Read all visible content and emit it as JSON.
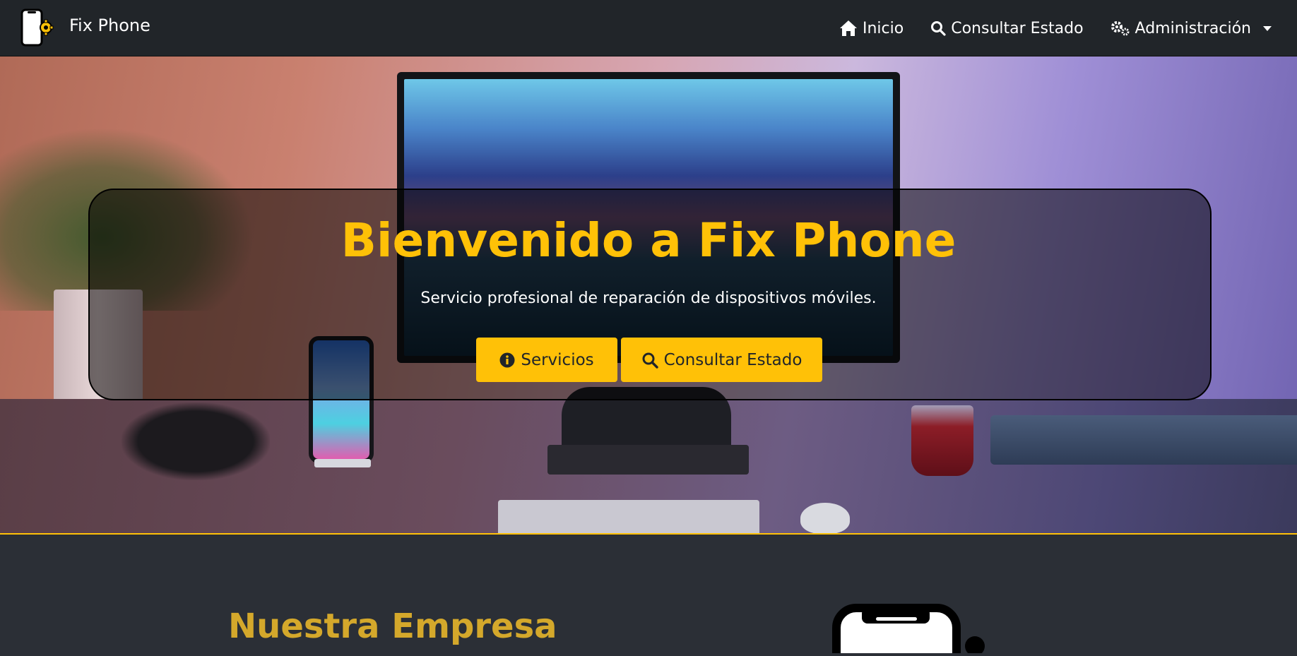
{
  "navbar": {
    "brand_name": "Fix Phone",
    "brand_icon": "phone-gear-logo",
    "items": [
      {
        "label": "Inicio",
        "icon": "home-icon"
      },
      {
        "label": "Consultar Estado",
        "icon": "search-icon"
      },
      {
        "label": "Administración",
        "icon": "gears-icon",
        "dropdown": true
      }
    ]
  },
  "hero": {
    "title": "Bienvenido a Fix Phone",
    "subtitle": "Servicio profesional de reparación de dispositivos móviles.",
    "buttons": [
      {
        "label": "Servicios",
        "icon": "info-circle-icon"
      },
      {
        "label": "Consultar Estado",
        "icon": "search-icon"
      }
    ]
  },
  "section": {
    "title": "Nuestra Empresa"
  },
  "colors": {
    "accent": "#ffc107",
    "navbar_bg": "#212529",
    "page_bg": "#2b2f36",
    "section_title": "#d4a82b"
  }
}
